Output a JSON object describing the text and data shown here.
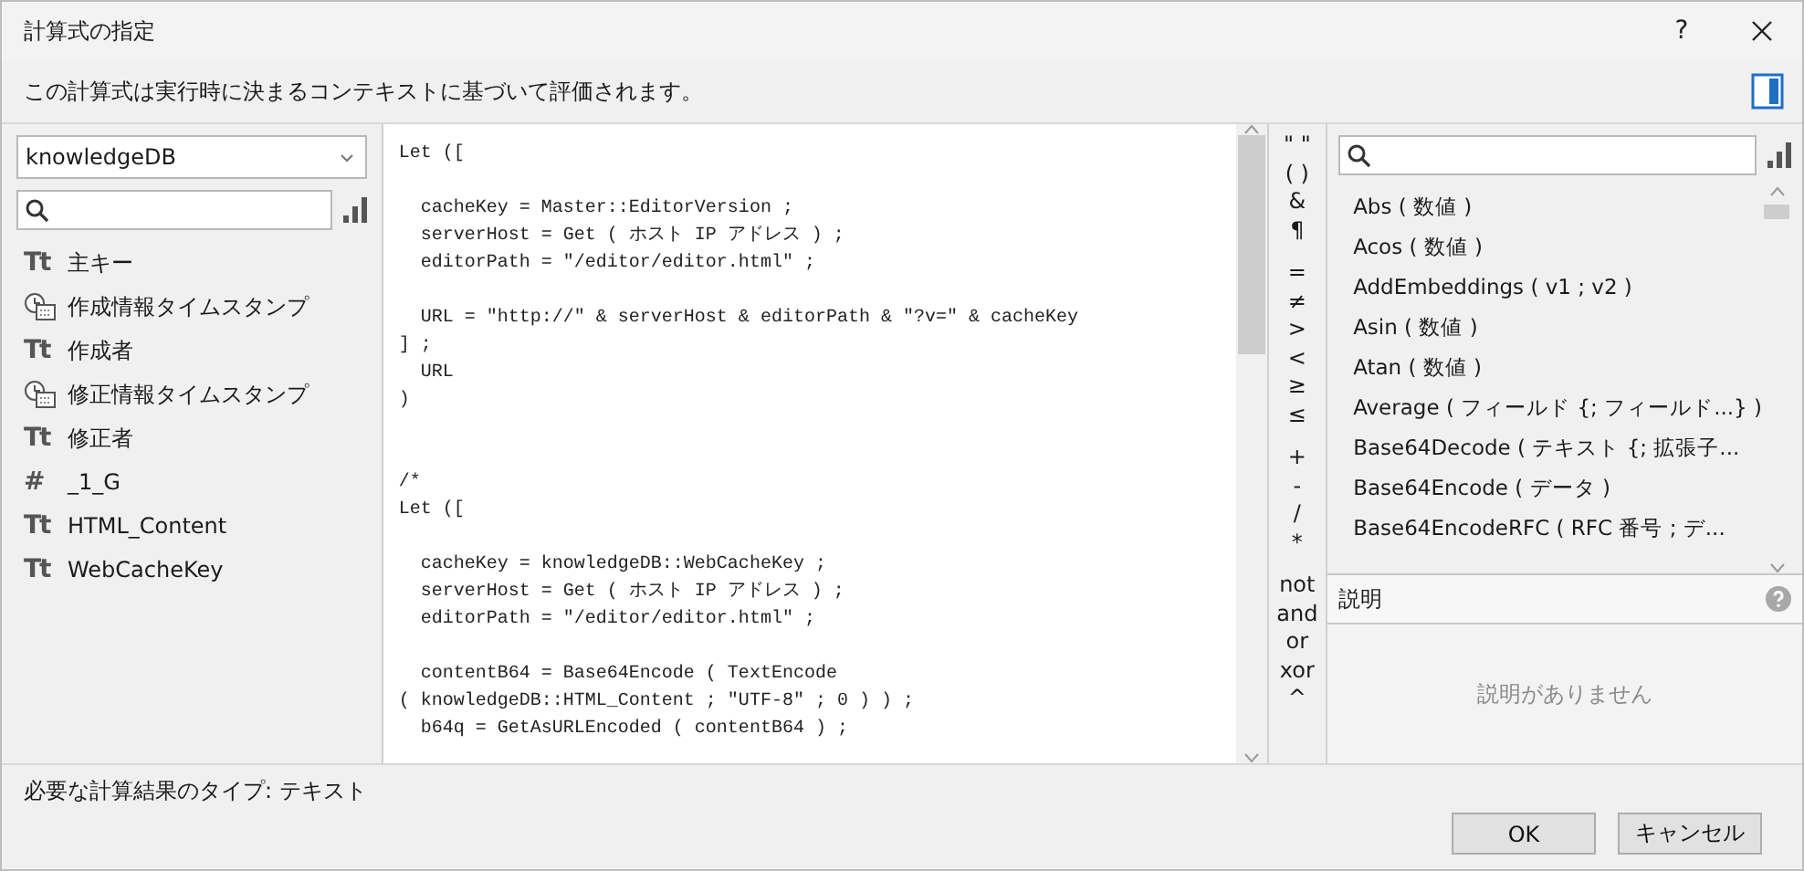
{
  "window": {
    "title": "計算式の指定",
    "help": "?"
  },
  "context_note": "この計算式は実行時に決まるコンテキストに基づいて評価されます。",
  "table_selector": {
    "value": "knowledgeDB"
  },
  "fields": [
    {
      "kind": "text",
      "icon": "Tt",
      "name": "主キー"
    },
    {
      "kind": "timestamp",
      "name": "作成情報タイムスタンプ"
    },
    {
      "kind": "text",
      "icon": "Tt",
      "name": "作成者"
    },
    {
      "kind": "timestamp",
      "name": "修正情報タイムスタンプ"
    },
    {
      "kind": "text",
      "icon": "Tt",
      "name": "修正者"
    },
    {
      "kind": "number",
      "icon": "#",
      "name": "_1_G"
    },
    {
      "kind": "text",
      "icon": "Tt",
      "name": "HTML_Content"
    },
    {
      "kind": "text",
      "icon": "Tt",
      "name": "WebCacheKey"
    }
  ],
  "formula": "Let ([\n\n  cacheKey = Master::EditorVersion ;\n  serverHost = Get ( ホスト IP アドレス ) ;\n  editorPath = \"/editor/editor.html\" ;\n\n  URL = \"http://\" & serverHost & editorPath & \"?v=\" & cacheKey\n] ;\n  URL\n)\n\n\n/*\nLet ([\n\n  cacheKey = knowledgeDB::WebCacheKey ;\n  serverHost = Get ( ホスト IP アドレス ) ;\n  editorPath = \"/editor/editor.html\" ;\n\n  contentB64 = Base64Encode ( TextEncode\n( knowledgeDB::HTML_Content ; \"UTF-8\" ; 0 ) ) ;\n  b64q = GetAsURLEncoded ( contentB64 ) ;",
  "operator_groups": [
    {
      "items": [
        "\" \"",
        "( )",
        "&",
        "¶"
      ]
    },
    {
      "items": [
        "=",
        "≠",
        ">",
        "<",
        "≥",
        "≤"
      ]
    },
    {
      "items": [
        "+",
        "-",
        "/",
        "*"
      ]
    },
    {
      "items": [
        "not",
        "and",
        "or",
        "xor",
        "^"
      ]
    }
  ],
  "functions": [
    "Abs ( 数値 )",
    "Acos ( 数値 )",
    "AddEmbeddings ( v1 ; v2 )",
    "Asin ( 数値 )",
    "Atan ( 数値 )",
    "Average ( フィールド {; フィールド...} )",
    "Base64Decode ( テキスト {; 拡張子...",
    "Base64Encode ( データ )",
    "Base64EncodeRFC ( RFC 番号 ; デ..."
  ],
  "description": {
    "title": "説明",
    "placeholder": "説明がありません"
  },
  "result_type": "必要な計算結果のタイプ: テキスト",
  "buttons": [
    "OK",
    "キャンセル"
  ]
}
